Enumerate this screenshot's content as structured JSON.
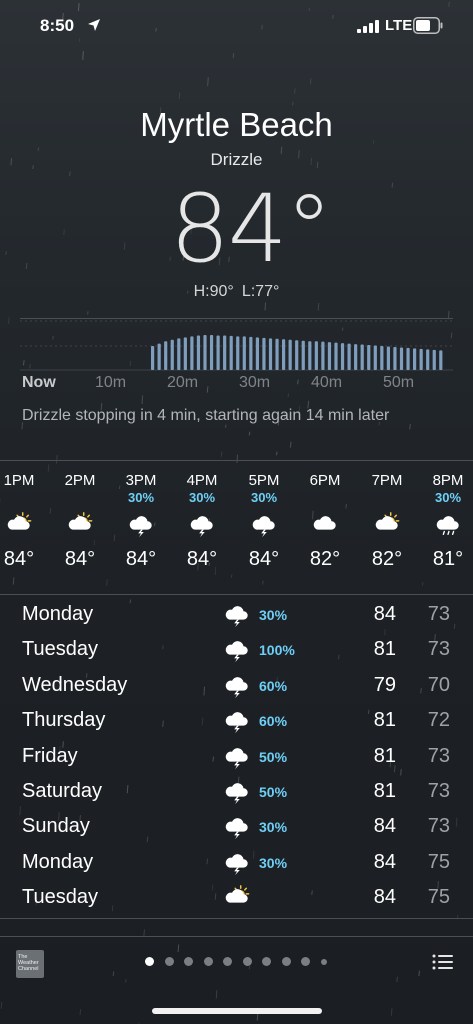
{
  "status_bar": {
    "time": "8:50",
    "network": "LTE",
    "location_icon": "location-arrow-icon",
    "signal_icon": "signal-bars-icon",
    "battery_icon": "battery-icon"
  },
  "current": {
    "city": "Myrtle Beach",
    "condition": "Drizzle",
    "temperature": "84°",
    "high": "H:90°",
    "low": "L:77°"
  },
  "precipitation": {
    "minute_labels": [
      "Now",
      "10m",
      "20m",
      "30m",
      "40m",
      "50m"
    ],
    "summary": "Drizzle stopping in 4 min, starting again 14 min later",
    "bar_intensity": [
      0.5,
      0.55,
      0.6,
      0.63,
      0.66,
      0.68,
      0.7,
      0.72,
      0.73,
      0.73,
      0.72,
      0.72,
      0.71,
      0.7,
      0.7,
      0.69,
      0.68,
      0.67,
      0.66,
      0.65,
      0.64,
      0.63,
      0.62,
      0.61,
      0.6,
      0.6,
      0.59,
      0.58,
      0.57,
      0.56,
      0.55,
      0.54,
      0.53,
      0.52,
      0.51,
      0.5,
      0.49,
      0.48,
      0.47,
      0.46,
      0.45,
      0.44,
      0.43,
      0.42,
      0.41
    ],
    "bar_color": "#8fb3d6"
  },
  "hourly": [
    {
      "time": "1PM",
      "pct": "",
      "icon": "partly-sunny-icon",
      "temp": "84°"
    },
    {
      "time": "2PM",
      "pct": "",
      "icon": "partly-sunny-icon",
      "temp": "84°"
    },
    {
      "time": "3PM",
      "pct": "30%",
      "icon": "thunderstorm-icon",
      "temp": "84°"
    },
    {
      "time": "4PM",
      "pct": "30%",
      "icon": "thunderstorm-icon",
      "temp": "84°"
    },
    {
      "time": "5PM",
      "pct": "30%",
      "icon": "thunderstorm-icon",
      "temp": "84°"
    },
    {
      "time": "6PM",
      "pct": "",
      "icon": "cloud-icon",
      "temp": "82°"
    },
    {
      "time": "7PM",
      "pct": "",
      "icon": "partly-sunny-icon",
      "temp": "82°"
    },
    {
      "time": "8PM",
      "pct": "30%",
      "icon": "rain-icon",
      "temp": "81°"
    }
  ],
  "daily": [
    {
      "day": "Monday",
      "icon": "thunderstorm-icon",
      "pct": "30%",
      "high": "84",
      "low": "73"
    },
    {
      "day": "Tuesday",
      "icon": "thunderstorm-icon",
      "pct": "100%",
      "high": "81",
      "low": "73"
    },
    {
      "day": "Wednesday",
      "icon": "thunderstorm-icon",
      "pct": "60%",
      "high": "79",
      "low": "70"
    },
    {
      "day": "Thursday",
      "icon": "thunderstorm-icon",
      "pct": "60%",
      "high": "81",
      "low": "72"
    },
    {
      "day": "Friday",
      "icon": "thunderstorm-icon",
      "pct": "50%",
      "high": "81",
      "low": "73"
    },
    {
      "day": "Saturday",
      "icon": "thunderstorm-icon",
      "pct": "50%",
      "high": "81",
      "low": "73"
    },
    {
      "day": "Sunday",
      "icon": "thunderstorm-icon",
      "pct": "30%",
      "high": "84",
      "low": "73"
    },
    {
      "day": "Monday",
      "icon": "thunderstorm-icon",
      "pct": "30%",
      "high": "84",
      "low": "75"
    },
    {
      "day": "Tuesday",
      "icon": "partly-sunny-icon",
      "pct": "",
      "high": "84",
      "low": "75"
    }
  ],
  "footer": {
    "logo_text": "The Weather Channel",
    "page_count": 10,
    "active_page": 0,
    "list_icon": "list-icon"
  },
  "colors": {
    "precip_pct": "#6ecff6",
    "sun": "#f5c542",
    "cloud": "#ffffff"
  }
}
